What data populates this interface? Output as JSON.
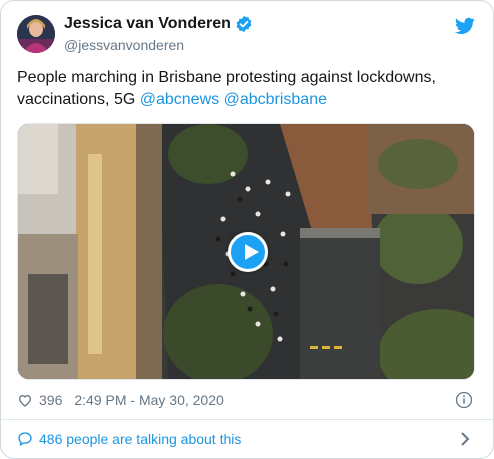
{
  "tweet": {
    "display_name": "Jessica van Vonderen",
    "handle": "@jessvanvonderen",
    "text_plain": "People marching in Brisbane protesting against lockdowns, vaccinations, 5G ",
    "mention_1": "@abcnews",
    "mention_2": "@abcbrisbane",
    "likes": "396",
    "timestamp": "2:49 PM - May 30, 2020",
    "talking": "486 people are talking about this"
  },
  "icons": {
    "verified": "verified-badge-icon",
    "bird": "twitter-bird-icon",
    "play": "play-icon",
    "heart": "heart-icon",
    "info": "info-icon",
    "bubble": "speech-bubble-icon",
    "chevron": "chevron-right-icon"
  },
  "colors": {
    "link": "#1b95e0",
    "brand": "#1da1f2",
    "secondary_text": "#657786"
  }
}
